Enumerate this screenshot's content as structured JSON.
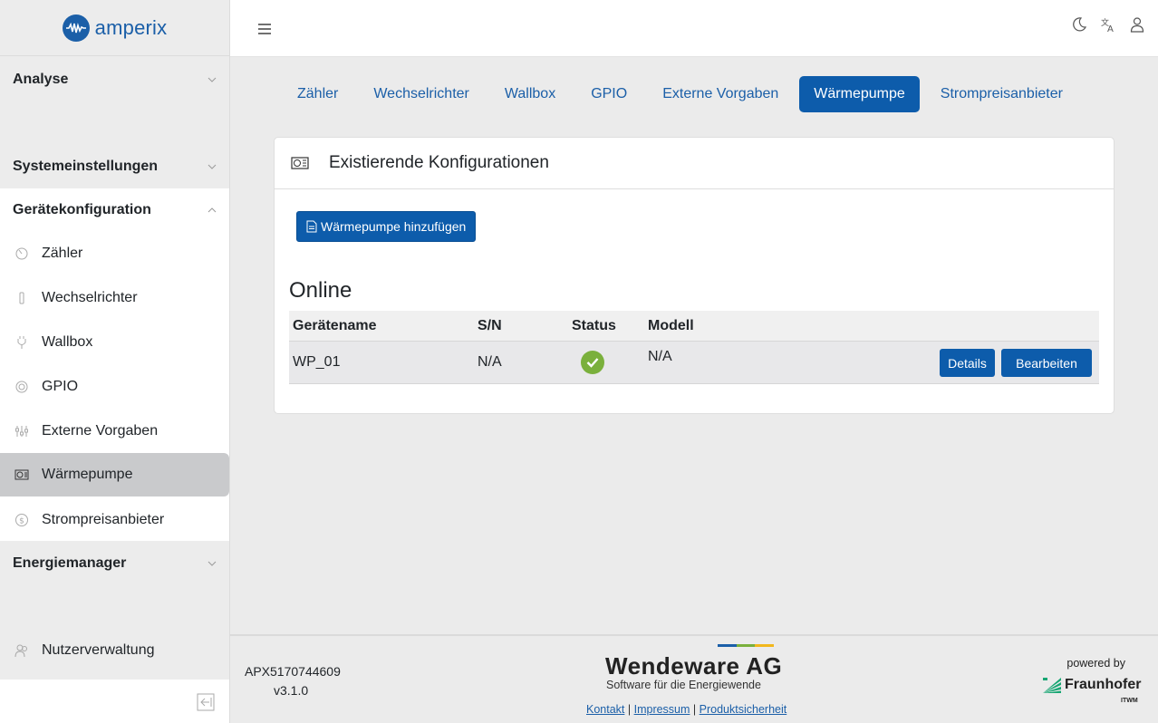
{
  "app": {
    "logo_text": "amperix",
    "brand_color": "#1b5fa8"
  },
  "sidebar": {
    "sections": [
      {
        "label": "Analyse"
      },
      {
        "label": "Systemeinstellungen"
      },
      {
        "label": "Gerätekonfiguration"
      },
      {
        "label": "Energiemanager"
      }
    ],
    "items": [
      {
        "label": "Zähler",
        "icon": "meter-icon"
      },
      {
        "label": "Wechselrichter",
        "icon": "inverter-icon"
      },
      {
        "label": "Wallbox",
        "icon": "plug-icon"
      },
      {
        "label": "GPIO",
        "icon": "gpio-icon"
      },
      {
        "label": "Externe Vorgaben",
        "icon": "sliders-icon"
      },
      {
        "label": "Wärmepumpe",
        "icon": "heat-pump-icon",
        "active": true
      },
      {
        "label": "Strompreisanbieter",
        "icon": "currency-icon"
      }
    ],
    "user_management": "Nutzerverwaltung"
  },
  "tabs": [
    {
      "label": "Zähler"
    },
    {
      "label": "Wechselrichter"
    },
    {
      "label": "Wallbox"
    },
    {
      "label": "GPIO"
    },
    {
      "label": "Externe Vorgaben"
    },
    {
      "label": "Wärmepumpe",
      "active": true
    },
    {
      "label": "Strompreisanbieter"
    }
  ],
  "card": {
    "title": "Existierende Konfigurationen",
    "add_button": "Wärmepumpe hinzufügen",
    "section_title": "Online",
    "columns": [
      "Gerätename",
      "S/N",
      "Status",
      "Modell"
    ],
    "rows": [
      {
        "name": "WP_01",
        "sn": "N/A",
        "status": "ok",
        "model": "N/A",
        "details_label": "Details",
        "edit_label": "Bearbeiten"
      }
    ]
  },
  "footer": {
    "serial": "APX5170744609",
    "version": "v3.1.0",
    "brand": "Wendeware AG",
    "brand_sub": "Software für die Energiewende",
    "links": [
      "Kontakt",
      "Impressum",
      "Produktsicherheit"
    ],
    "separator": "|",
    "powered_by": "powered by",
    "partner": "Fraunhofer",
    "partner_sub": "ITWM",
    "brand_bar_colors": [
      "#1b5fa8",
      "#7ab03c",
      "#f2b71c"
    ]
  }
}
